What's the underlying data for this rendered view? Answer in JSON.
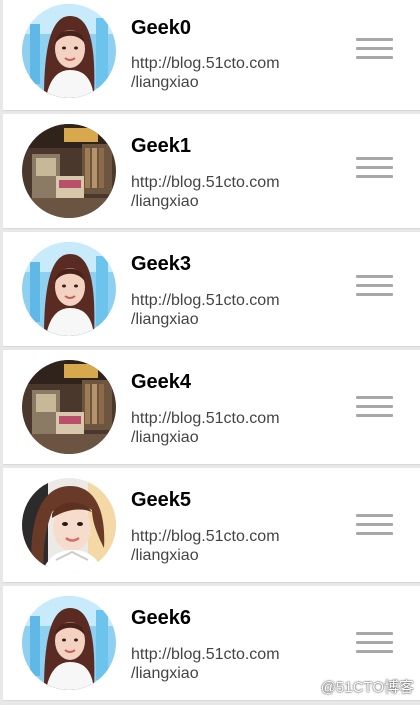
{
  "items": [
    {
      "title": "Geek0",
      "url_line1": "http://blog.51cto.com",
      "url_line2": "/liangxiao",
      "avatar": "photo-blue-portrait-icon"
    },
    {
      "title": "Geek1",
      "url_line1": "http://blog.51cto.com",
      "url_line2": "/liangxiao",
      "avatar": "photo-bookshelf-scene-icon"
    },
    {
      "title": "Geek3",
      "url_line1": "http://blog.51cto.com",
      "url_line2": "/liangxiao",
      "avatar": "photo-blue-portrait-icon"
    },
    {
      "title": "Geek4",
      "url_line1": "http://blog.51cto.com",
      "url_line2": "/liangxiao",
      "avatar": "photo-bookshelf-scene-icon"
    },
    {
      "title": "Geek5",
      "url_line1": "http://blog.51cto.com",
      "url_line2": "/liangxiao",
      "avatar": "photo-selfie-portrait-icon"
    },
    {
      "title": "Geek6",
      "url_line1": "http://blog.51cto.com",
      "url_line2": "/liangxiao",
      "avatar": "photo-blue-portrait-icon"
    }
  ],
  "watermark": "@51CTO博客",
  "colors": {
    "row_background": "#ffffff",
    "separator": "#d8d8d8",
    "title_text": "#000000",
    "url_text": "#444444",
    "drag_handle": "#a7a7a7"
  },
  "icons": {
    "drag_handle": "drag-handle-icon"
  }
}
